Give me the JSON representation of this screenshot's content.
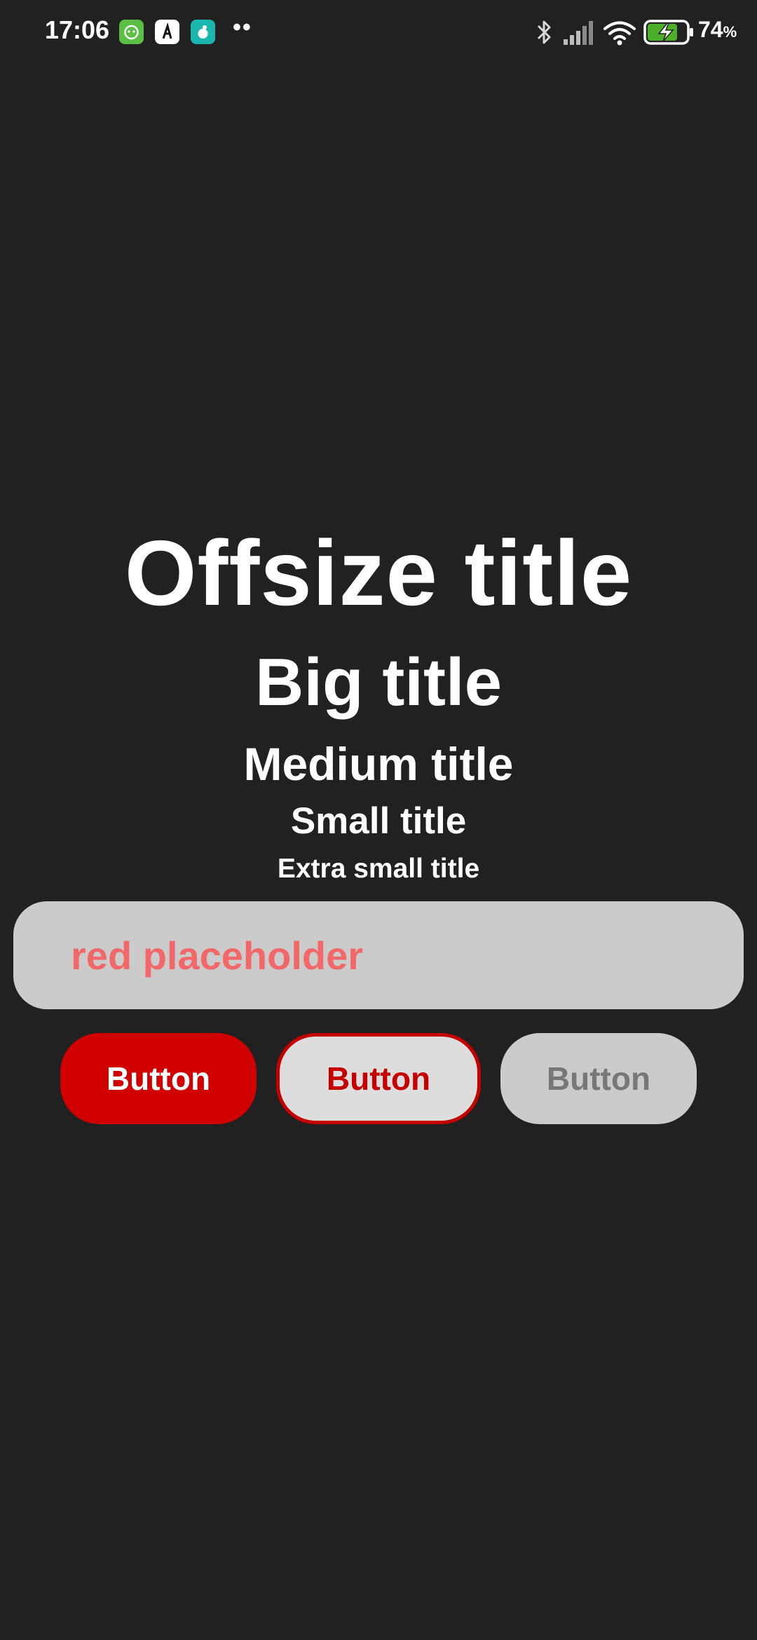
{
  "status_bar": {
    "time": "17:06",
    "more_indicator": "••",
    "battery_value": "74",
    "battery_unit": "%",
    "icons": [
      "app-notification-green-icon",
      "app-notification-white-icon",
      "app-notification-teal-icon",
      "bluetooth-icon",
      "cell-signal-icon",
      "wifi-icon",
      "battery-charging-icon"
    ]
  },
  "titles": {
    "offsize": "Offsize title",
    "big": "Big title",
    "medium": "Medium title",
    "small": "Small title",
    "extra_small": "Extra small title"
  },
  "input": {
    "value": "",
    "placeholder": "red placeholder"
  },
  "buttons": {
    "primary_label": "Button",
    "outline_label": "Button",
    "disabled_label": "Button"
  },
  "colors": {
    "background": "#212121",
    "primary": "#d10000",
    "placeholder": "#f26868",
    "input_background": "#cbcbcb",
    "disabled_text": "#777777"
  }
}
